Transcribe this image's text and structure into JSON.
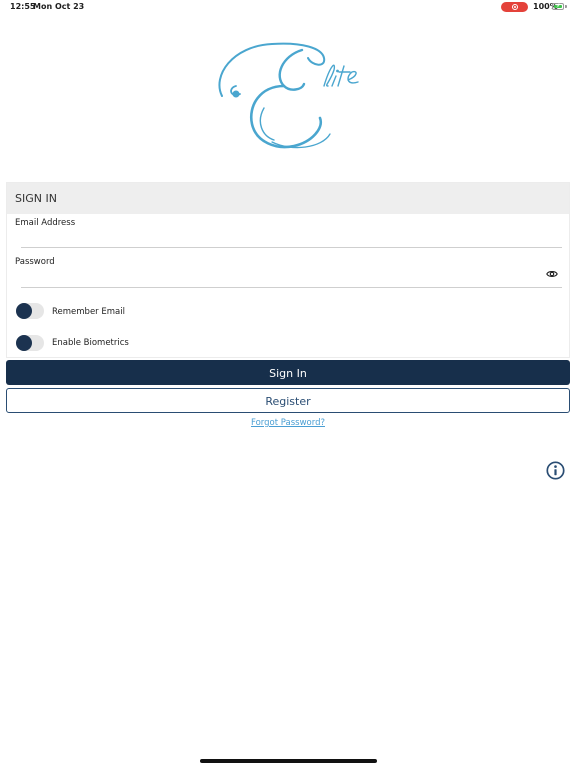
{
  "status_bar": {
    "time": "12:55",
    "date": "Mon Oct 23",
    "battery_percent": "100%",
    "recording_color": "#e4423a",
    "battery_color": "#3ec34a"
  },
  "logo": {
    "text": "Elite",
    "color": "#4aa6cf"
  },
  "signin": {
    "header": "SIGN IN",
    "email_label": "Email Address",
    "email_value": "",
    "password_label": "Password",
    "password_value": "",
    "password_visibility_icon": "eye-icon",
    "remember_email_label": "Remember Email",
    "remember_email_on": false,
    "biometrics_label": "Enable Biometrics",
    "biometrics_on": false
  },
  "actions": {
    "signin_label": "Sign In",
    "register_label": "Register",
    "forgot_label": "Forgot Password?"
  },
  "info_icon": "info-icon",
  "colors": {
    "primary": "#172f4b",
    "link": "#4a9ed3",
    "toggle_knob": "#1c3350"
  }
}
